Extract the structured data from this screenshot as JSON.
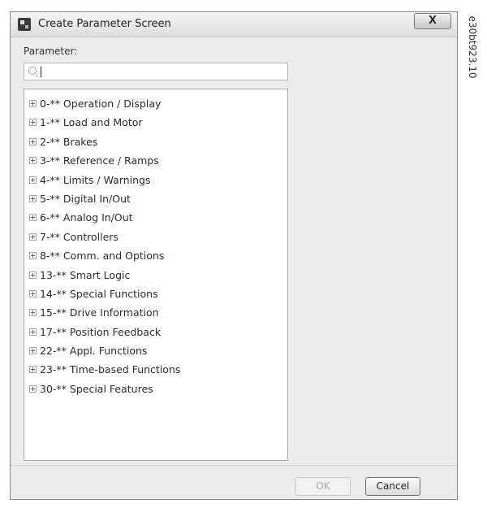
{
  "window": {
    "title": "Create Parameter Screen",
    "close_label": "X"
  },
  "search": {
    "label": "Parameter:",
    "value": ""
  },
  "tree": {
    "items": [
      {
        "label": "0-** Operation / Display"
      },
      {
        "label": "1-** Load and Motor"
      },
      {
        "label": "2-** Brakes"
      },
      {
        "label": "3-** Reference / Ramps"
      },
      {
        "label": "4-** Limits / Warnings"
      },
      {
        "label": "5-** Digital In/Out"
      },
      {
        "label": "6-** Analog In/Out"
      },
      {
        "label": "7-** Controllers"
      },
      {
        "label": "8-** Comm. and Options"
      },
      {
        "label": "13-** Smart Logic"
      },
      {
        "label": "14-** Special Functions"
      },
      {
        "label": "15-** Drive Information"
      },
      {
        "label": "17-** Position Feedback"
      },
      {
        "label": "22-** Appl. Functions"
      },
      {
        "label": "23-** Time-based Functions"
      },
      {
        "label": "30-** Special Features"
      }
    ]
  },
  "buttons": {
    "ok_label": "OK",
    "cancel_label": "Cancel"
  },
  "figure_id": "e30bt923.10"
}
